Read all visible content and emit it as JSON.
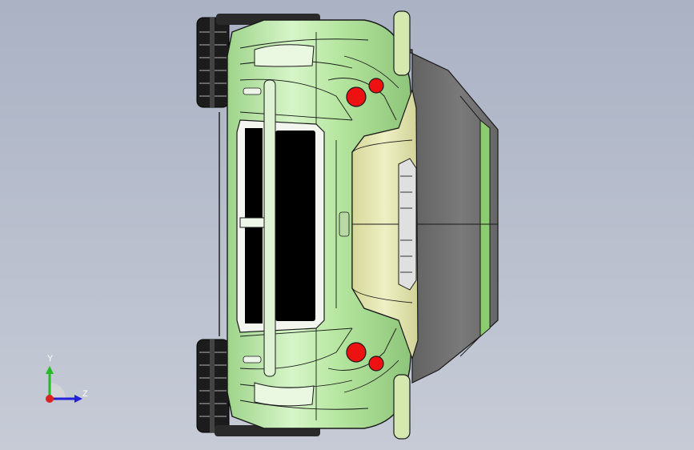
{
  "viewport": {
    "background_top": "#aab2c4",
    "background_bottom": "#c6cbd6"
  },
  "model": {
    "body_color": "#c8eeb8",
    "hood_color": "#e4e6b0",
    "glass_color": "#707070",
    "tire_color": "#1c1c1c",
    "lamp_color": "#ee1111",
    "edge_color": "#1a1a1a"
  },
  "triad": {
    "y_label": "Y",
    "z_label": "Z",
    "y_color": "#22bb22",
    "z_color": "#2222dd",
    "x_color": "#dd2222"
  }
}
